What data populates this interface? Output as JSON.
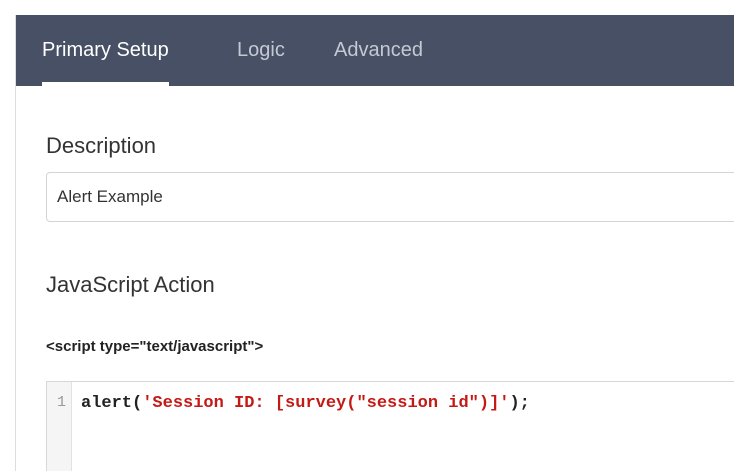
{
  "tabs": [
    {
      "label": "Primary Setup",
      "active": true
    },
    {
      "label": "Logic",
      "active": false
    },
    {
      "label": "Advanced",
      "active": false
    }
  ],
  "description": {
    "label": "Description",
    "value": "Alert Example"
  },
  "javascript_action": {
    "label": "JavaScript Action",
    "script_tag": "<script type=\"text/javascript\">",
    "editor": {
      "line_number": "1",
      "code_prefix": "alert(",
      "code_string": "'Session ID: [survey(\"session id\")]'",
      "code_suffix": ");"
    }
  },
  "colors": {
    "tabbar_background": "#475064",
    "active_tab_text": "#ffffff",
    "inactive_tab_text": "#c4c9d4",
    "code_string": "#c41a16"
  }
}
